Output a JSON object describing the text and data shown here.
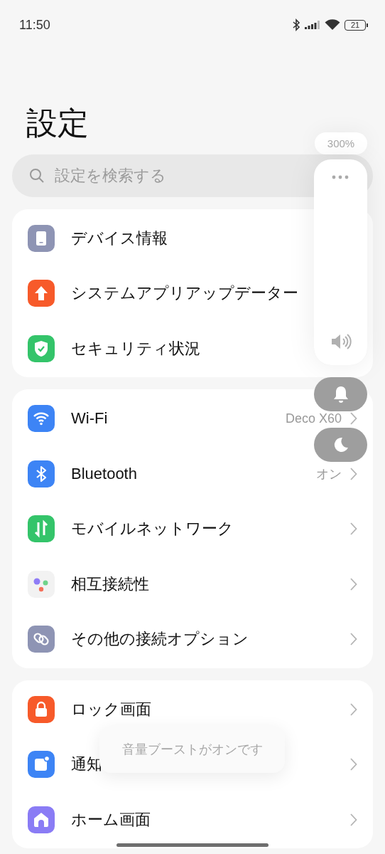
{
  "status_bar": {
    "time": "11:50",
    "battery": "21"
  },
  "title": "設定",
  "search": {
    "placeholder": "設定を検索する"
  },
  "sections": [
    {
      "chevrons": false,
      "rows": [
        {
          "kind": "device",
          "color": "#8e94b4",
          "label": "デバイス情報"
        },
        {
          "kind": "update",
          "color": "#f75a2a",
          "label": "システムアプリアップデーター"
        },
        {
          "kind": "shield",
          "color": "#34c46a",
          "label": "セキュリティ状況"
        }
      ]
    },
    {
      "rows": [
        {
          "kind": "wifi",
          "color": "#3d84f5",
          "label": "Wi-Fi",
          "value": "Deco X60"
        },
        {
          "kind": "bluetooth",
          "color": "#3d84f5",
          "label": "Bluetooth",
          "value": "オン"
        },
        {
          "kind": "mobile",
          "color": "#34c46a",
          "label": "モバイルネットワーク"
        },
        {
          "kind": "dots",
          "color": "#f2f2f2",
          "label": "相互接続性"
        },
        {
          "kind": "link",
          "color": "#8e94b4",
          "label": "その他の接続オプション"
        }
      ]
    },
    {
      "rows": [
        {
          "kind": "lock",
          "color": "#f75a2a",
          "label": "ロック画面"
        },
        {
          "kind": "notify",
          "color": "#3d84f5",
          "label": "通知"
        },
        {
          "kind": "home",
          "color": "#8a7cf5",
          "label": "ホーム画面"
        }
      ]
    }
  ],
  "volume_panel": {
    "boost": "300%",
    "level": 1.0
  },
  "toast": "音量ブーストがオンです"
}
